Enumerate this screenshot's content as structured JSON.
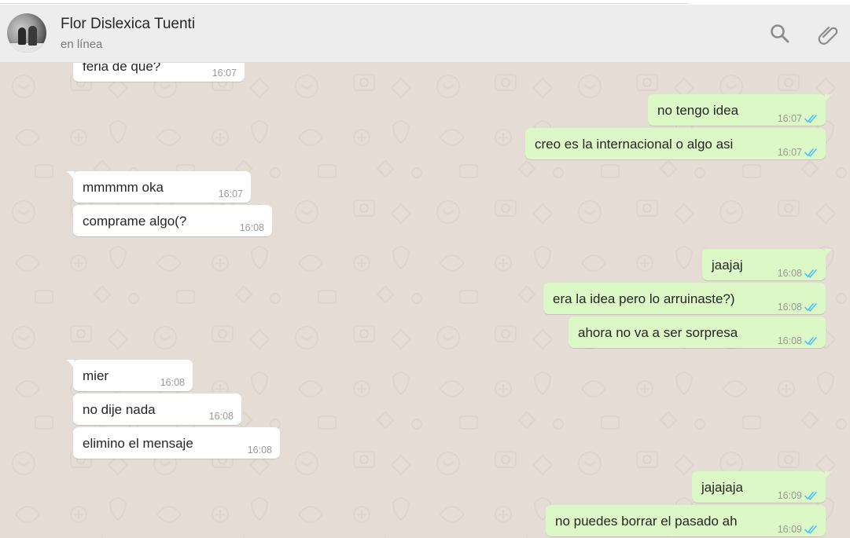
{
  "contact": {
    "name": "Flor Dislexica Tuenti",
    "status": "en línea"
  },
  "icons": {
    "search": "search-icon",
    "attach": "paperclip-icon",
    "read_receipt": "double-check-icon"
  },
  "colors": {
    "header_bg": "#ededed",
    "chat_bg": "#e5ddd5",
    "incoming_bubble": "#ffffff",
    "outgoing_bubble": "#dcf8c6",
    "read_ticks": "#4fc3f7"
  },
  "messages": [
    {
      "direction": "in",
      "text": "feria de que?",
      "time": "16:07"
    },
    {
      "direction": "out",
      "text": "no tengo idea",
      "time": "16:07",
      "status": "read"
    },
    {
      "direction": "out",
      "text": "creo es la internacional  o algo asi",
      "time": "16:07",
      "status": "read"
    },
    {
      "direction": "in",
      "text": "mmmmm oka",
      "time": "16:07"
    },
    {
      "direction": "in",
      "text": "comprame algo(?",
      "time": "16:08"
    },
    {
      "direction": "out",
      "text": "jaajaj",
      "time": "16:08",
      "status": "read"
    },
    {
      "direction": "out",
      "text": "era la  idea pero lo arruinaste?)",
      "time": "16:08",
      "status": "read"
    },
    {
      "direction": "out",
      "text": "ahora  no va a ser sorpresa",
      "time": "16:08",
      "status": "read"
    },
    {
      "direction": "in",
      "text": "mier",
      "time": "16:08"
    },
    {
      "direction": "in",
      "text": "no dije nada",
      "time": "16:08"
    },
    {
      "direction": "in",
      "text": "elimino el mensaje",
      "time": "16:08"
    },
    {
      "direction": "out",
      "text": "jajajaja",
      "time": "16:09",
      "status": "read"
    },
    {
      "direction": "out",
      "text": "no puedes borrar el pasado ah",
      "time": "16:09",
      "status": "read"
    }
  ]
}
